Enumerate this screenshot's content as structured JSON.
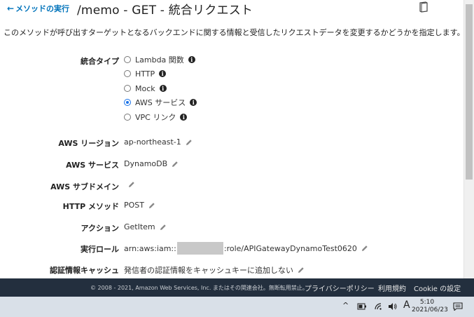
{
  "header": {
    "back_link": "メソッドの実行",
    "title": "/memo - GET - 統合リクエスト"
  },
  "description": "このメソッドが呼び出すターゲットとなるバックエンドに関する情報と受信したリクエストデータを変更するかどうかを指定します。",
  "integration": {
    "label": "統合タイプ",
    "options": [
      {
        "label": "Lambda 関数",
        "selected": false
      },
      {
        "label": "HTTP",
        "selected": false
      },
      {
        "label": "Mock",
        "selected": false
      },
      {
        "label": "AWS サービス",
        "selected": true
      },
      {
        "label": "VPC リンク",
        "selected": false
      }
    ]
  },
  "fields": {
    "region_label": "AWS リージョン",
    "region_value": "ap-northeast-1",
    "service_label": "AWS サービス",
    "service_value": "DynamoDB",
    "subdomain_label": "AWS サブドメイン",
    "subdomain_value": "",
    "http_method_label": "HTTP メソッド",
    "http_method_value": "POST",
    "action_label": "アクション",
    "action_value": "GetItem",
    "exec_role_label": "実行ロール",
    "exec_role_prefix": "arn:aws:iam::",
    "exec_role_suffix": ":role/APIGatewayDynamoTest0620",
    "cred_cache_label": "認証情報キャッシュ",
    "cred_cache_value": "発信者の認証情報をキャッシュキーに追加しない"
  },
  "footer": {
    "copyright": "© 2008 - 2021, Amazon Web Services, Inc. またはその関連会社。無断転用禁止。",
    "privacy": "プライバシーポリシー",
    "terms": "利用規約",
    "cookie": "Cookie の設定"
  },
  "taskbar": {
    "ime": "A",
    "time": "5:10",
    "date": "2021/06/23"
  },
  "colors": {
    "link": "#0073bb",
    "footer_bg": "#232f3e",
    "radio_selected": "#1a73e8"
  }
}
